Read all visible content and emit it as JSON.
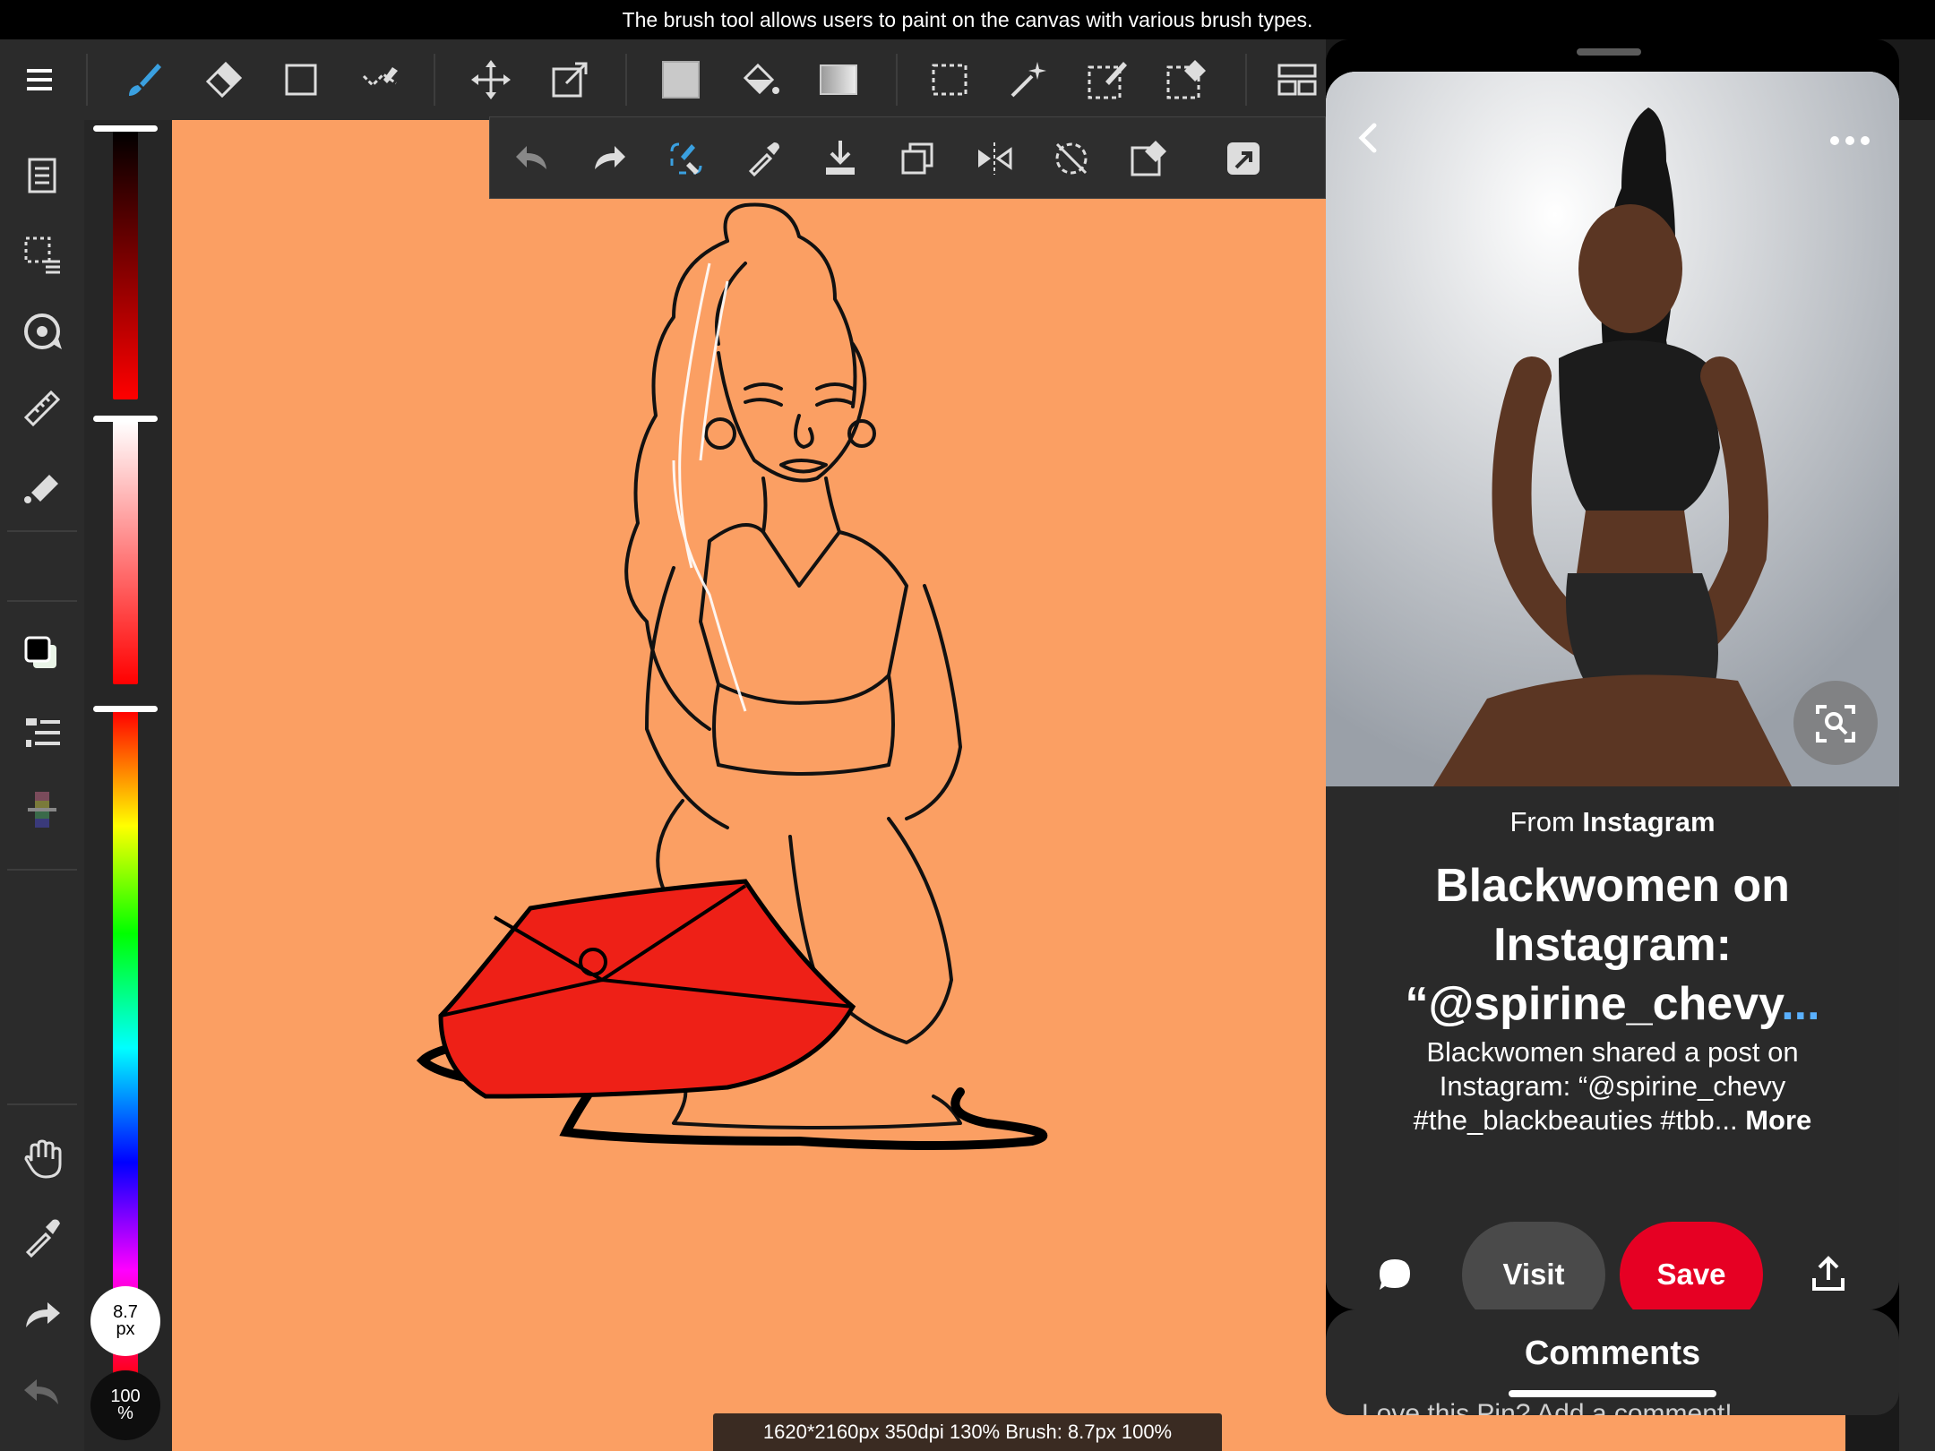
{
  "tooltip": "The brush tool allows users to paint on the canvas with various brush types.",
  "toolbar": {
    "tools": [
      "menu-icon",
      "brush-icon",
      "eraser-icon",
      "rectangle-icon",
      "smudge-icon",
      "move-icon",
      "transform-icon",
      "fill-color-icon",
      "bucket-icon",
      "gradient-icon",
      "select-rect-icon",
      "magic-wand-icon",
      "select-pen-icon",
      "select-eraser-icon",
      "layout-icon"
    ]
  },
  "sub_toolbar": {
    "tools": [
      "undo-icon",
      "redo-icon",
      "clear-icon",
      "eyedropper-icon",
      "download-icon",
      "duplicate-icon",
      "flip-icon",
      "rotate-off-icon",
      "deselect-icon",
      "share-icon"
    ]
  },
  "sidebar": {
    "tools": [
      "layers-icon",
      "selection-icon",
      "transform-rotate-icon",
      "ruler-icon",
      "fill-icon",
      "color-swatch-icon",
      "layer-list-icon",
      "palette-icon",
      "hand-icon",
      "eyedropper-icon",
      "redo-icon",
      "undo-icon"
    ]
  },
  "brush": {
    "size_value": "8.7",
    "size_unit": "px",
    "opacity_value": "100",
    "opacity_unit": "%"
  },
  "colors": {
    "canvas": "#fb9f63",
    "primary": "#000000",
    "secondary": "#eaf5e8",
    "save_button": "#e60023",
    "accent_brush": "#3aa0e0"
  },
  "status_bar": "1620*2160px 350dpi 130% Brush: 8.7px 100%",
  "pinterest": {
    "source_prefix": "From",
    "source_name": "Instagram",
    "title": "Blackwomen on Instagram: “@spirine_chevy",
    "title_ellipsis": "...",
    "description": "Blackwomen shared a post on Instagram: “@spirine_chevy #the_blackbeauties #tbb...",
    "more_label": "More",
    "visit_label": "Visit",
    "save_label": "Save",
    "comments_title": "Comments",
    "comment_placeholder": "Love this Pin? Add a comment!"
  }
}
